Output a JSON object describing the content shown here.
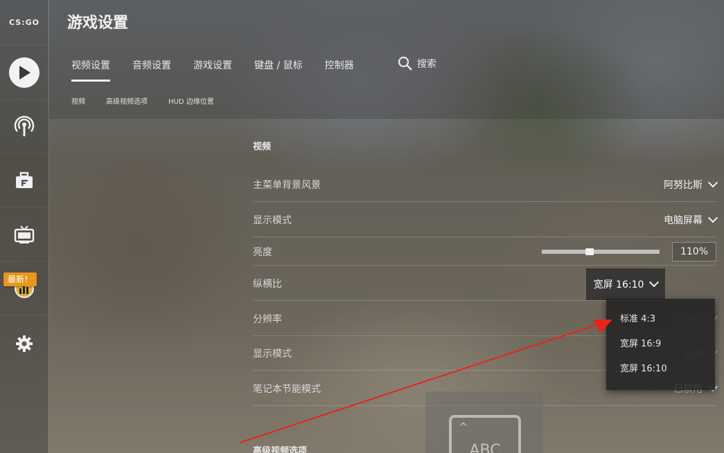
{
  "logo": "CS:GO",
  "badge_new": "最新！",
  "header": {
    "title": "游戏设置",
    "tabs": [
      {
        "label": "视频设置"
      },
      {
        "label": "音频设置"
      },
      {
        "label": "游戏设置"
      },
      {
        "label": "键盘 / 鼠标"
      },
      {
        "label": "控制器"
      }
    ],
    "search_label": "搜索",
    "subtabs": [
      {
        "label": "视频"
      },
      {
        "label": "高级视频选项"
      },
      {
        "label": "HUD 边缘位置"
      }
    ]
  },
  "main": {
    "section_title": "视频",
    "rows": {
      "menu_bg": {
        "label": "主菜单背景风景",
        "value": "阿努比斯"
      },
      "display_mode": {
        "label": "显示模式",
        "value": "电脑屏幕"
      },
      "brightness": {
        "label": "亮度",
        "value": "110%",
        "level": 0.4
      },
      "aspect": {
        "label": "纵横比",
        "value": "宽屏 16:10"
      },
      "resolution": {
        "label": "分辨率",
        "value": "1680"
      },
      "display_mode2": {
        "label": "显示模式",
        "value": "全屏"
      },
      "laptop_power": {
        "label": "笔记本节能模式",
        "value": "已禁用"
      }
    },
    "aspect_options": [
      "标准 4:3",
      "宽屏 16:9",
      "宽屏 16:10"
    ],
    "bottom_section_title": "高级视频选项",
    "keyboard_card_text": "ABC"
  },
  "colors": {
    "badge": "#e8961e",
    "arrow": "#e8241a"
  }
}
